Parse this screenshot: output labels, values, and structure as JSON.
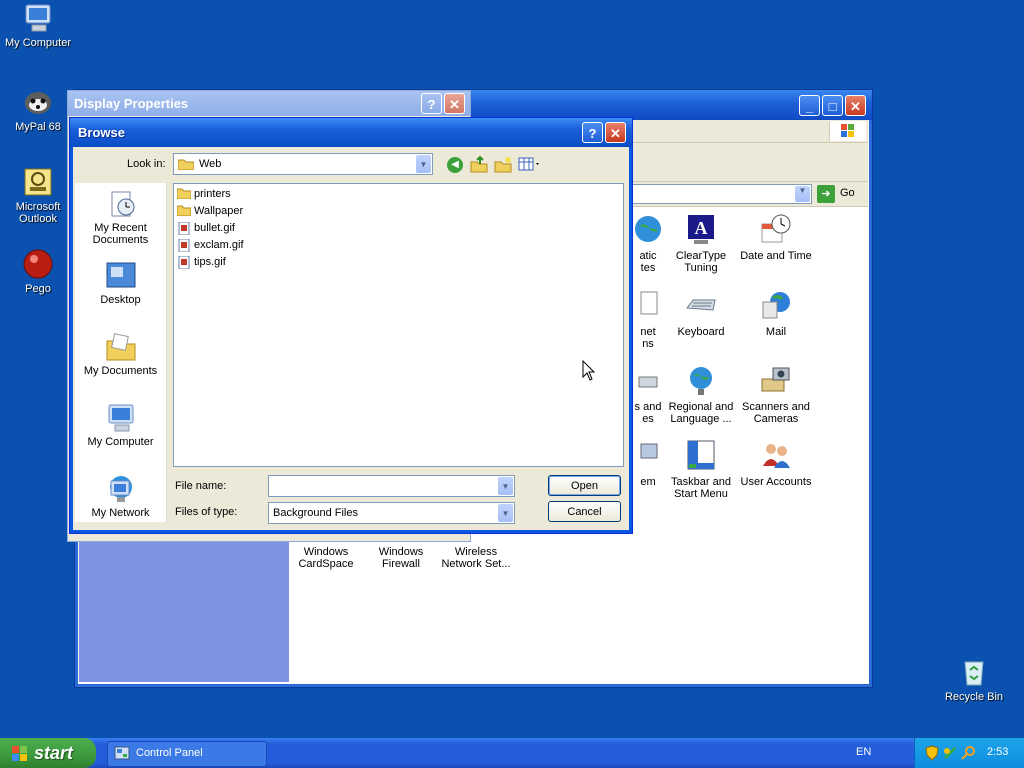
{
  "desktop": {
    "icons": [
      {
        "label": "My Computer",
        "icon": "my-computer-icon"
      },
      {
        "label": "MyPal 68",
        "icon": "mypal-icon"
      },
      {
        "label": "Microsoft Outlook",
        "icon": "outlook-icon"
      },
      {
        "label": "Pego",
        "icon": "pego-icon"
      },
      {
        "label": "Recycle Bin",
        "icon": "recycle-bin-icon"
      }
    ]
  },
  "control_panel": {
    "go_label": "Go",
    "icons": [
      {
        "label": "atic\ntes"
      },
      {
        "label": "ClearType Tuning"
      },
      {
        "label": "Date and Time"
      },
      {
        "label": "net\nns"
      },
      {
        "label": "Keyboard"
      },
      {
        "label": "Mail"
      },
      {
        "label": "s and\nes"
      },
      {
        "label": "Regional and Language ..."
      },
      {
        "label": "Scanners and Cameras"
      },
      {
        "label": "em"
      },
      {
        "label": "Taskbar and Start Menu"
      },
      {
        "label": "User Accounts"
      },
      {
        "label": "Windows CardSpace"
      },
      {
        "label": "Windows Firewall"
      },
      {
        "label": "Wireless Network Set..."
      }
    ]
  },
  "display_properties": {
    "title": "Display Properties"
  },
  "browse": {
    "title": "Browse",
    "look_in_label": "Look in:",
    "look_in_value": "Web",
    "places": [
      {
        "label": "My Recent Documents"
      },
      {
        "label": "Desktop"
      },
      {
        "label": "My Documents"
      },
      {
        "label": "My Computer"
      },
      {
        "label": "My Network"
      }
    ],
    "files": [
      {
        "name": "printers",
        "type": "folder"
      },
      {
        "name": "Wallpaper",
        "type": "folder"
      },
      {
        "name": "bullet.gif",
        "type": "gif"
      },
      {
        "name": "exclam.gif",
        "type": "gif"
      },
      {
        "name": "tips.gif",
        "type": "gif"
      }
    ],
    "file_name_label": "File name:",
    "file_name_value": "",
    "files_of_type_label": "Files of type:",
    "files_of_type_value": "Background Files",
    "open_label": "Open",
    "cancel_label": "Cancel"
  },
  "taskbar": {
    "start_label": "start",
    "task_label": "Control Panel",
    "language": "EN",
    "clock": "2:53"
  }
}
